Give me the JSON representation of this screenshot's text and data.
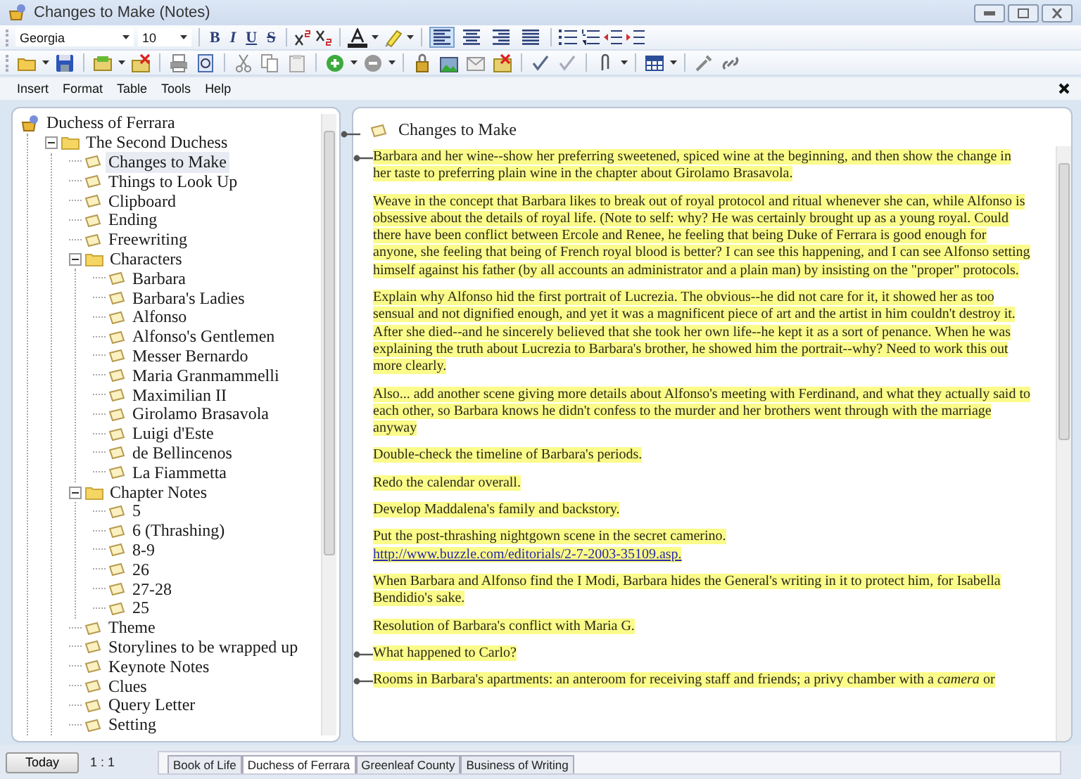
{
  "window": {
    "title": "Changes to Make (Notes)"
  },
  "format_toolbar": {
    "font": "Georgia",
    "size": "10",
    "style_buttons": [
      "B",
      "I",
      "U",
      "S"
    ],
    "alignment": [
      {
        "selected": true
      },
      {
        "selected": false
      },
      {
        "selected": false
      },
      {
        "selected": false
      }
    ]
  },
  "menu": [
    "Insert",
    "Format",
    "Table",
    "Tools",
    "Help"
  ],
  "tree": {
    "label": "Duchess of Ferrara",
    "kind": "root",
    "children": [
      {
        "label": "The Second Duchess",
        "kind": "folder",
        "expanded": true,
        "selected": false,
        "children": [
          {
            "label": "Changes to Make",
            "kind": "note",
            "selected": true
          },
          {
            "label": "Things to Look Up",
            "kind": "note",
            "selected": false
          },
          {
            "label": "Clipboard",
            "kind": "note",
            "selected": false
          },
          {
            "label": "Ending",
            "kind": "note",
            "selected": false
          },
          {
            "label": "Freewriting",
            "kind": "note",
            "selected": false
          },
          {
            "label": "Characters",
            "kind": "folder",
            "expanded": true,
            "selected": false,
            "children": [
              {
                "label": "Barbara",
                "kind": "note",
                "selected": false
              },
              {
                "label": "Barbara's Ladies",
                "kind": "note",
                "selected": false
              },
              {
                "label": "Alfonso",
                "kind": "note",
                "selected": false
              },
              {
                "label": "Alfonso's Gentlemen",
                "kind": "note",
                "selected": false
              },
              {
                "label": "Messer Bernardo",
                "kind": "note",
                "selected": false
              },
              {
                "label": "Maria Granmammelli",
                "kind": "note",
                "selected": false
              },
              {
                "label": "Maximilian II",
                "kind": "note",
                "selected": false
              },
              {
                "label": "Girolamo Brasavola",
                "kind": "note",
                "selected": false
              },
              {
                "label": "Luigi d'Este",
                "kind": "note",
                "selected": false
              },
              {
                "label": "de Bellincenos",
                "kind": "note",
                "selected": false
              },
              {
                "label": "La Fiammetta",
                "kind": "note",
                "selected": false
              }
            ]
          },
          {
            "label": "Chapter Notes",
            "kind": "folder",
            "expanded": true,
            "selected": false,
            "children": [
              {
                "label": "5",
                "kind": "note",
                "selected": false
              },
              {
                "label": "6 (Thrashing)",
                "kind": "note",
                "selected": false
              },
              {
                "label": "8-9",
                "kind": "note",
                "selected": false
              },
              {
                "label": "26",
                "kind": "note",
                "selected": false
              },
              {
                "label": "27-28",
                "kind": "note",
                "selected": false
              },
              {
                "label": "25",
                "kind": "note",
                "selected": false
              }
            ]
          },
          {
            "label": "Theme",
            "kind": "note",
            "selected": false
          },
          {
            "label": " Storylines to be wrapped up",
            "kind": "note",
            "selected": false
          },
          {
            "label": "Keynote Notes",
            "kind": "note",
            "selected": false
          },
          {
            "label": "Clues",
            "kind": "note",
            "selected": false
          },
          {
            "label": "Query Letter",
            "kind": "note",
            "selected": false
          },
          {
            "label": "Setting",
            "kind": "note",
            "selected": false
          }
        ]
      }
    ]
  },
  "editor": {
    "title": "Changes to Make",
    "bookmarked": true,
    "paragraphs": [
      {
        "text": "Barbara and her wine--show her preferring sweetened, spiced wine at the beginning, and then show the change in her taste to preferring plain wine in the chapter about Girolamo Brasavola.",
        "bookmarked": true
      },
      {
        "text": "Weave in the concept that Barbara likes to break out of royal protocol and ritual whenever she can, while Alfonso is obsessive about the details of royal life. (Note to self: why? He was certainly brought up as a young royal. Could there have been conflict between Ercole and Renee, he feeling that being Duke of Ferrara is good enough for anyone, she feeling that being of French royal blood is better? I can see this happening, and I can see Alfonso setting himself against his father (by all accounts an administrator and a plain man) by insisting on the \"proper\" protocols.",
        "bookmarked": false
      },
      {
        "text": "Explain why Alfonso hid the first portrait of Lucrezia. The obvious--he did not care for it, it showed her as too sensual and not dignified enough, and yet it was a magnificent piece of art and the artist in him couldn't destroy it. After she died--and he sincerely believed that she took her own life--he kept it as a sort of penance. When he was explaining the truth about Lucrezia to Barbara's brother, he showed him the portrait--why? Need to work this out more clearly.",
        "bookmarked": false
      },
      {
        "text": "Also... add another scene giving more details about Alfonso's meeting with Ferdinand, and what they actually said to each other, so Barbara knows he didn't confess to the murder and her brothers went through with the marriage anyway",
        "bookmarked": false
      },
      {
        "text": "Double-check the timeline of Barbara's periods.",
        "bookmarked": false
      },
      {
        "text": "Redo the calendar overall.",
        "bookmarked": false
      },
      {
        "text": "Develop Maddalena's family and backstory.",
        "bookmarked": false
      },
      {
        "text": "Put the post-thrashing nightgown scene in the secret camerino.",
        "link": "http://www.buzzle.com/editorials/2-7-2003-35109.asp.",
        "bookmarked": false
      },
      {
        "text": "When Barbara and Alfonso find the I Modi, Barbara hides the General's writing in it to protect him, for Isabella Bendidio's sake.",
        "bookmarked": false
      },
      {
        "text": "Resolution of Barbara's conflict with Maria G.",
        "bookmarked": false
      },
      {
        "text": "What happened to Carlo?",
        "bookmarked": true
      },
      {
        "text": "Rooms in Barbara's apartments: an anteroom for receiving staff and friends; a privy chamber with a *camera* or",
        "bookmarked": true
      }
    ]
  },
  "status_bar": {
    "today_button": "Today",
    "position": "1 : 1",
    "tabs": [
      {
        "label": "Book of Life",
        "selected": false
      },
      {
        "label": "Duchess of Ferrara",
        "selected": true
      },
      {
        "label": "Greenleaf County",
        "selected": false
      },
      {
        "label": "Business of Writing",
        "selected": false
      }
    ]
  }
}
